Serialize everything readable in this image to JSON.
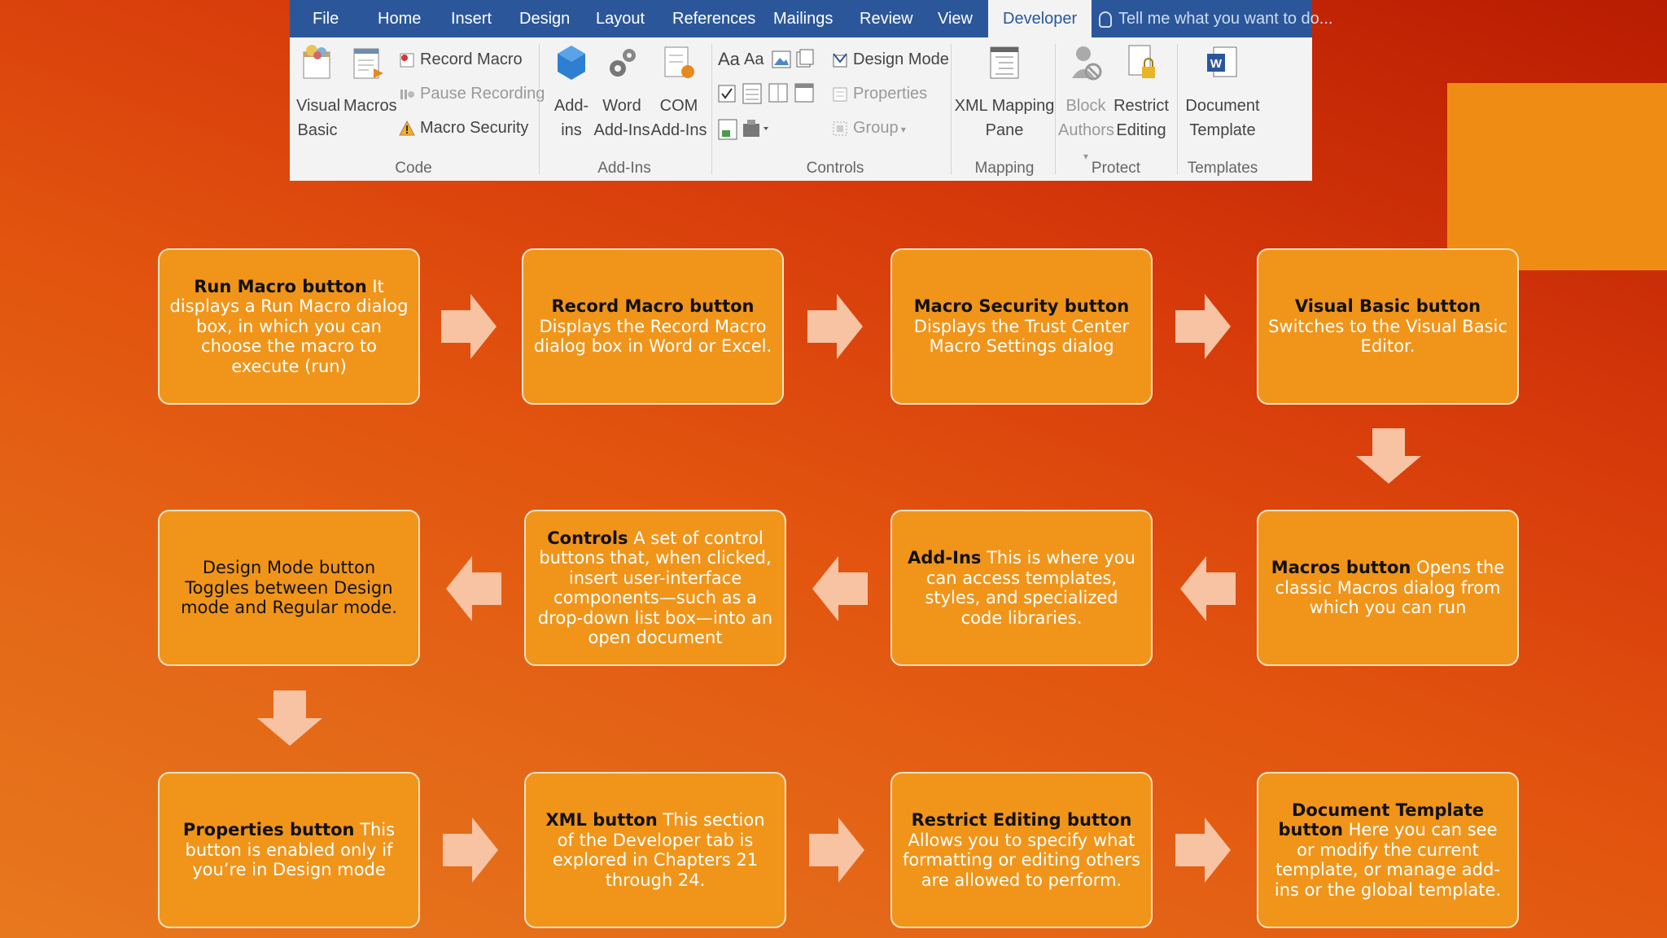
{
  "ribbon": {
    "tabs": [
      "File",
      "Home",
      "Insert",
      "Design",
      "Layout",
      "References",
      "Mailings",
      "Review",
      "View"
    ],
    "active_tab": "Developer",
    "tell_me": "Tell me what you want to do...",
    "code": {
      "visual_basic": [
        "Visual",
        "Basic"
      ],
      "macros": "Macros",
      "record_macro": "Record Macro",
      "pause_recording": "Pause Recording",
      "macro_security": "Macro Security",
      "label": "Code"
    },
    "addins": {
      "addins": [
        "Add-",
        "ins"
      ],
      "word_addins": [
        "Word",
        "Add-Ins"
      ],
      "com_addins": [
        "COM",
        "Add-Ins"
      ],
      "label": "Add-Ins"
    },
    "controls": {
      "design_mode": "Design Mode",
      "properties": "Properties",
      "group": "Group",
      "label": "Controls"
    },
    "mapping": {
      "xml_mapping": [
        "XML Mapping",
        "Pane"
      ],
      "label": "Mapping"
    },
    "protect": {
      "block_authors": [
        "Block",
        "Authors"
      ],
      "restrict_editing": [
        "Restrict",
        "Editing"
      ],
      "label": "Protect"
    },
    "templates": {
      "document_template": [
        "Document",
        "Template"
      ],
      "label": "Templates"
    }
  },
  "flow": [
    {
      "title": "Run Macro button",
      "desc": " It displays a Run Macro dialog box, in which you can choose the macro to execute (run)"
    },
    {
      "title": "Record Macro button",
      "desc": "Displays the Record Macro dialog box in Word or Excel."
    },
    {
      "title": "Macro Security button",
      "desc": "Displays the Trust Center Macro Settings dialog"
    },
    {
      "title": "Visual Basic button",
      "desc": "Switches to the Visual Basic Editor."
    },
    {
      "title": "Macros button",
      "desc": " Opens the classic Macros dialog from which you can run"
    },
    {
      "title": "Add-Ins",
      "desc": " This is where you can access templates, styles, and specialized code libraries."
    },
    {
      "title": "Controls",
      "desc": " A set of control buttons that, when clicked, insert user-interface components—such as a drop-down list box—into an open document"
    },
    {
      "title": "",
      "desc": "Design Mode button Toggles between Design mode and Regular mode."
    },
    {
      "title": "Properties button",
      "desc": " This button is enabled only if you’re in Design mode"
    },
    {
      "title": "XML button",
      "desc": " This section of the Developer tab is explored in Chapters 21 through 24."
    },
    {
      "title": "Restrict Editing button",
      "desc": " Allows you to specify what formatting or editing others are allowed to perform."
    },
    {
      "title": "Document Template button",
      "desc": "  Here you can see or modify the current template, or manage add-ins or the global template."
    }
  ],
  "colors": {
    "box_fill": "#f0951a",
    "box_border": "#fbe2c4",
    "arrow": "#f7c3a2",
    "ribbon_tab_bar": "#2b579a"
  }
}
